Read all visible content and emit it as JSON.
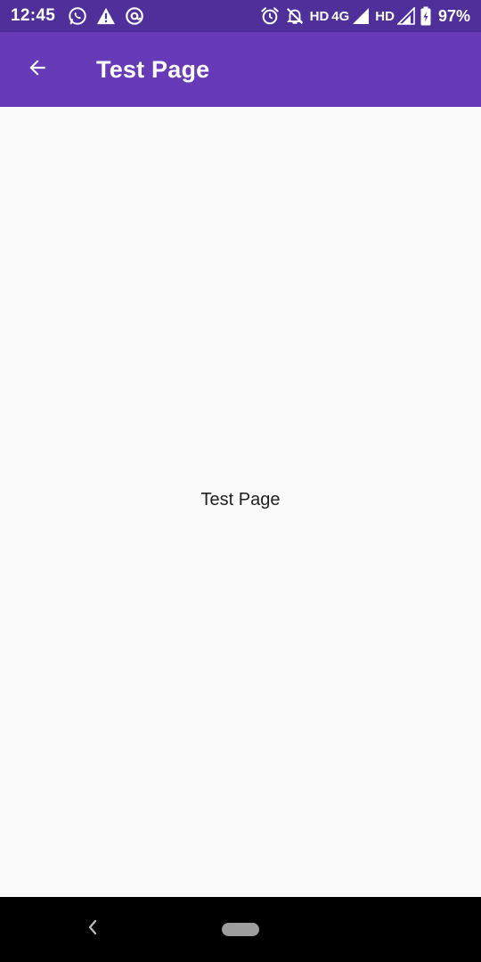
{
  "status_bar": {
    "time": "12:45",
    "left_icons": [
      "whatsapp-icon",
      "warning-icon",
      "at-sign-icon"
    ],
    "right_icons": [
      "alarm-icon",
      "notifications-off-icon"
    ],
    "network_1": "HD",
    "network_type": "4G",
    "network_2": "HD",
    "battery_percent": "97%"
  },
  "app_bar": {
    "title": "Test Page",
    "background": "#673ab7",
    "back_icon": "arrow-back-icon"
  },
  "body": {
    "center_text": "Test Page"
  },
  "nav_bar": {
    "back_icon": "chevron-left-icon",
    "home_icon": "home-pill-icon"
  }
}
